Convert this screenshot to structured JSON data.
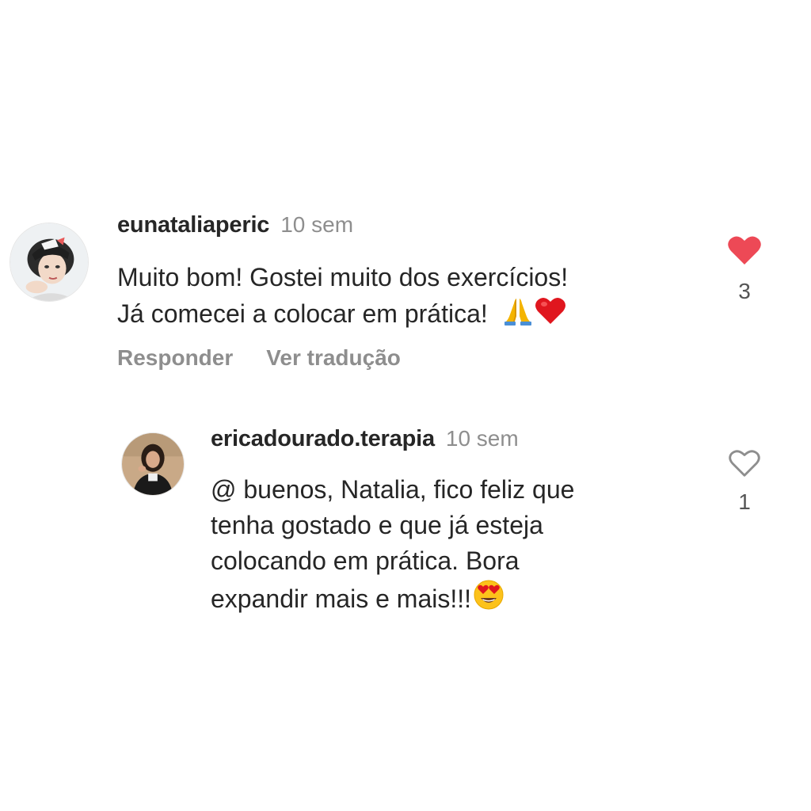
{
  "comments": [
    {
      "username": "eunataliaperic",
      "time": "10 sem",
      "lines": [
        "Muito bom! Gostei muito dos exercícios!",
        "Já comecei a colocar em prática!"
      ],
      "emojis": [
        "folded-hands-emoji",
        "red-heart-emoji"
      ],
      "reply_label": "Responder",
      "translate_label": "Ver tradução",
      "likes": "3",
      "liked": true
    },
    {
      "username": "ericadourado.terapia",
      "time": "10 sem",
      "lines": [
        "@ buenos, Natalia, fico feliz que",
        "tenha gostado e que já esteja",
        "colocando em prática. Bora",
        "expandir mais e mais!!!"
      ],
      "emojis": [
        "heart-eyes-emoji"
      ],
      "likes": "1",
      "liked": false
    }
  ],
  "colors": {
    "text": "#262626",
    "secondary": "#8e8e8e",
    "like_red": "#ed4956"
  }
}
